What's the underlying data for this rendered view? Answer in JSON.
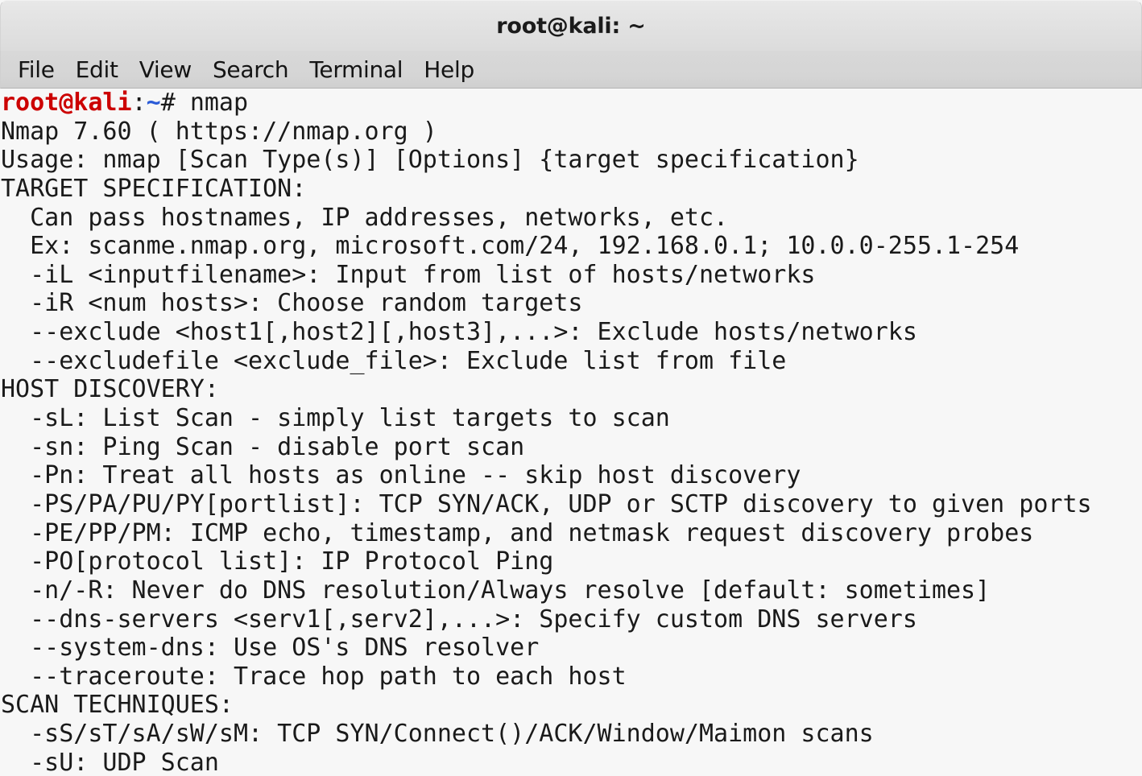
{
  "window": {
    "title": "root@kali: ~",
    "colors": {
      "titlebar_bg": "#e2e2e2",
      "menubar_bg": "#d5d5d5",
      "terminal_bg": "#f7f7f7",
      "terminal_fg": "#1a1a1a",
      "prompt_user": "#cc0000",
      "prompt_path": "#2a5bd7"
    }
  },
  "menubar": {
    "items": [
      {
        "label": "File"
      },
      {
        "label": "Edit"
      },
      {
        "label": "View"
      },
      {
        "label": "Search"
      },
      {
        "label": "Terminal"
      },
      {
        "label": "Help"
      }
    ]
  },
  "prompt": {
    "user_host": "root@kali",
    "colon": ":",
    "path": "~",
    "sigil": "# ",
    "command": "nmap"
  },
  "terminal": {
    "lines": [
      "Nmap 7.60 ( https://nmap.org )",
      "Usage: nmap [Scan Type(s)] [Options] {target specification}",
      "TARGET SPECIFICATION:",
      "  Can pass hostnames, IP addresses, networks, etc.",
      "  Ex: scanme.nmap.org, microsoft.com/24, 192.168.0.1; 10.0.0-255.1-254",
      "  -iL <inputfilename>: Input from list of hosts/networks",
      "  -iR <num hosts>: Choose random targets",
      "  --exclude <host1[,host2][,host3],...>: Exclude hosts/networks",
      "  --excludefile <exclude_file>: Exclude list from file",
      "HOST DISCOVERY:",
      "  -sL: List Scan - simply list targets to scan",
      "  -sn: Ping Scan - disable port scan",
      "  -Pn: Treat all hosts as online -- skip host discovery",
      "  -PS/PA/PU/PY[portlist]: TCP SYN/ACK, UDP or SCTP discovery to given ports",
      "  -PE/PP/PM: ICMP echo, timestamp, and netmask request discovery probes",
      "  -PO[protocol list]: IP Protocol Ping",
      "  -n/-R: Never do DNS resolution/Always resolve [default: sometimes]",
      "  --dns-servers <serv1[,serv2],...>: Specify custom DNS servers",
      "  --system-dns: Use OS's DNS resolver",
      "  --traceroute: Trace hop path to each host",
      "SCAN TECHNIQUES:",
      "  -sS/sT/sA/sW/sM: TCP SYN/Connect()/ACK/Window/Maimon scans",
      "  -sU: UDP Scan"
    ]
  }
}
